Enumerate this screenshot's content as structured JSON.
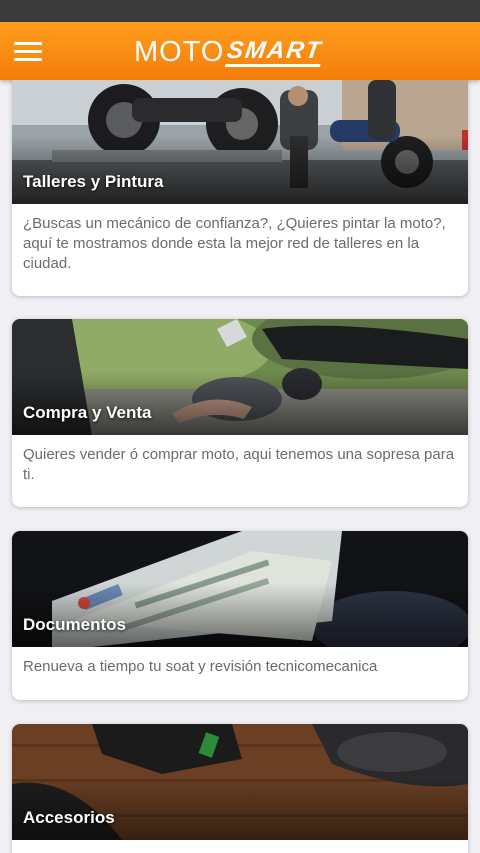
{
  "app": {
    "brand_left": "MOTO",
    "brand_right": "SMART",
    "accent_color": "#f7890f"
  },
  "cards": [
    {
      "title": "Talleres y Pintura",
      "description": "¿Buscas un mecánico de confianza?, ¿Quieres pintar la moto?, aquí te mostramos donde esta la mejor red de talleres en la ciudad."
    },
    {
      "title": "Compra y Venta",
      "description": "Quieres vender ó comprar moto, aqui tenemos una sopresa para ti."
    },
    {
      "title": "Documentos",
      "description": "Renueva a tiempo tu soat y revisión tecnicomecanica"
    },
    {
      "title": "Accesorios",
      "description": ""
    }
  ]
}
